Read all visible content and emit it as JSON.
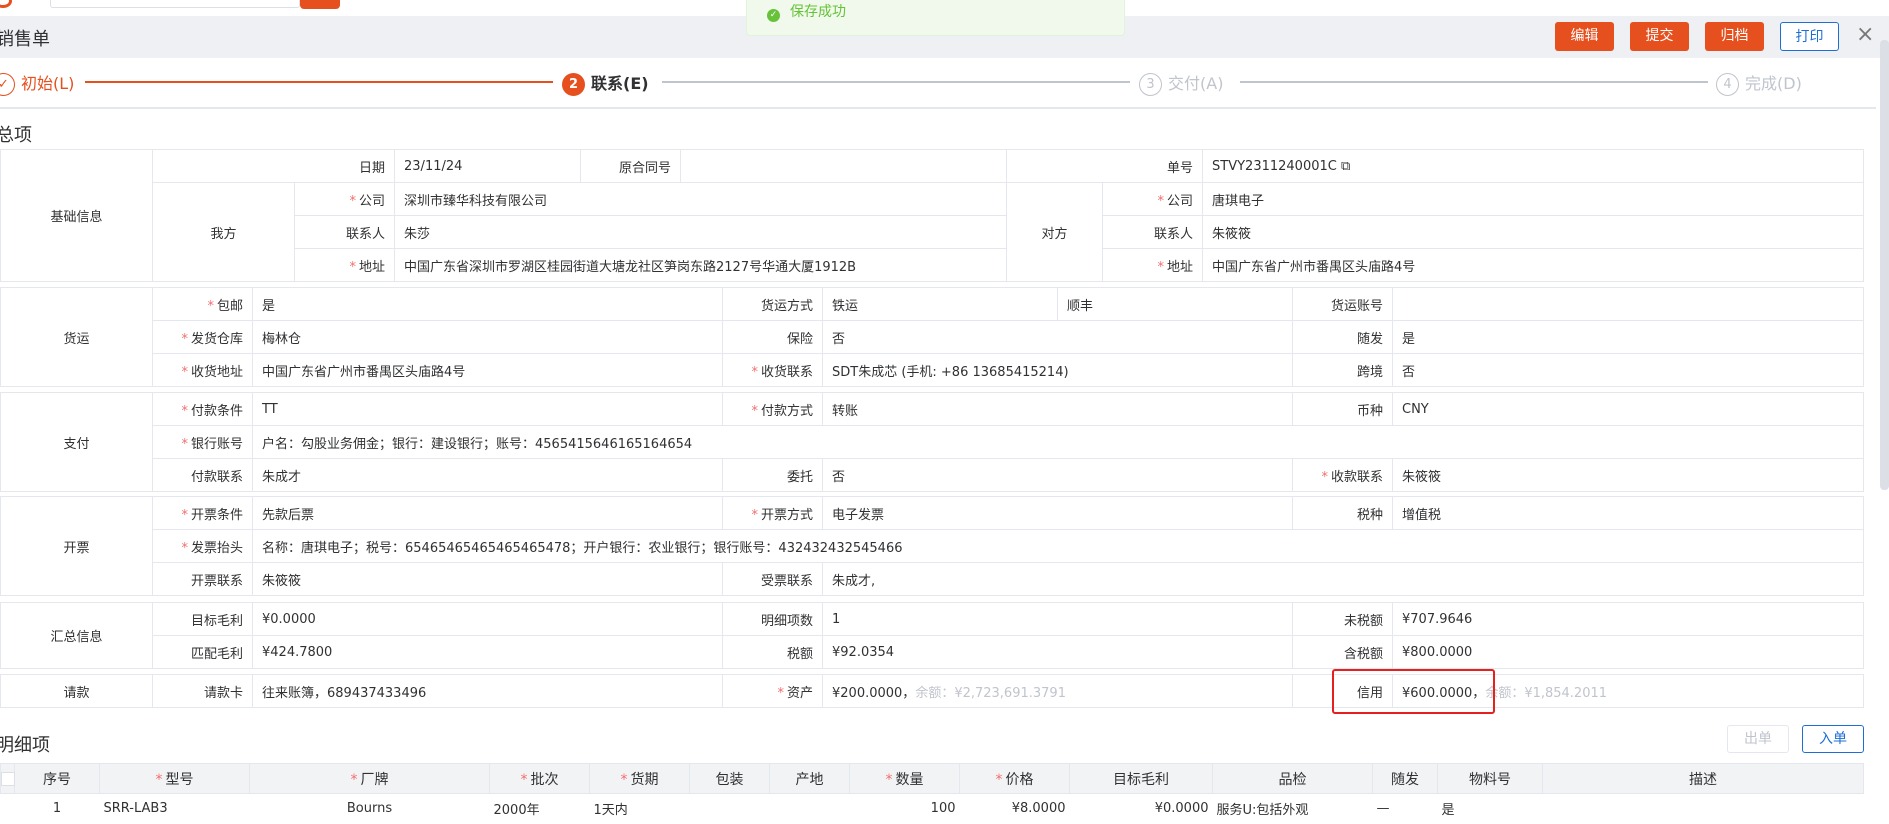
{
  "toast": {
    "text": "保存成功"
  },
  "header": {
    "title": "销售单",
    "buttons": {
      "edit": "编辑",
      "submit": "提交",
      "archive": "归档",
      "print": "打印"
    },
    "close": "×"
  },
  "steps": [
    {
      "num": "✓",
      "label": "初始(L)"
    },
    {
      "num": "2",
      "label": "联系(E)"
    },
    {
      "num": "3",
      "label": "交付(A)"
    },
    {
      "num": "4",
      "label": "完成(D)"
    }
  ],
  "summary": {
    "section_title": "总项",
    "basic": {
      "group": "基础信息",
      "date_label": "日期",
      "date": "23/11/24",
      "contract_label": "原合同号",
      "contract": "",
      "no_label": "单号",
      "no": "STVY2311240001C",
      "us_label": "我方",
      "them_label": "对方",
      "company_label": "公司",
      "contact_label": "联系人",
      "address_label": "地址",
      "us_company": "深圳市臻华科技有限公司",
      "us_contact": "朱莎",
      "us_address": "中国广东省深圳市罗湖区桂园街道大塘龙社区笋岗东路2127号华通大厦1912B",
      "them_company": "唐琪电子",
      "them_contact": "朱筱筱",
      "them_address": "中国广东省广州市番禺区头庙路4号"
    },
    "shipping": {
      "group": "货运",
      "free_label": "包邮",
      "free": "是",
      "method_label": "货运方式",
      "method": "铁运",
      "carrier": "顺丰",
      "account_label": "货运账号",
      "account": "",
      "warehouse_label": "发货仓库",
      "warehouse": "梅林仓",
      "insurance_label": "保险",
      "insurance": "否",
      "follow_label": "随发",
      "follow": "是",
      "recv_addr_label": "收货地址",
      "recv_addr": "中国广东省广州市番禺区头庙路4号",
      "recv_contact_label": "收货联系",
      "recv_contact": "SDT朱成芯 (手机: +86 13685415214)",
      "cross_label": "跨境",
      "cross": "否"
    },
    "payment": {
      "group": "支付",
      "terms_label": "付款条件",
      "terms": "TT",
      "method_label": "付款方式",
      "method": "转账",
      "currency_label": "币种",
      "currency": "CNY",
      "bank_label": "银行账号",
      "bank": "户名：勾股业务佣金；银行：建设银行；账号：4565415646165164654",
      "contact_label": "付款联系",
      "contact": "朱成才",
      "entrust_label": "委托",
      "entrust": "否",
      "recv_label": "收款联系",
      "recv": "朱筱筱"
    },
    "invoice": {
      "group": "开票",
      "terms_label": "开票条件",
      "terms": "先款后票",
      "method_label": "开票方式",
      "method": "电子发票",
      "tax_label": "税种",
      "tax": "增值税",
      "header_label": "发票抬头",
      "header": "名称：唐琪电子；税号：65465465465465465478；开户银行：农业银行；银行账号：432432432545466",
      "contact_label": "开票联系",
      "contact": "朱筱筱",
      "recv_label": "受票联系",
      "recv": "朱成才,"
    },
    "totals": {
      "group": "汇总信息",
      "target_label": "目标毛利",
      "target": "¥0.0000",
      "items_label": "明细项数",
      "items": "1",
      "pretax_label": "未税额",
      "pretax": "¥707.9646",
      "match_label": "匹配毛利",
      "match": "¥424.7800",
      "taxamt_label": "税额",
      "taxamt": "¥92.0354",
      "withtax_label": "含税额",
      "withtax": "¥800.0000"
    },
    "request": {
      "group": "请款",
      "card_label": "请款卡",
      "card": "往来账簿，689437433496",
      "asset_label": "资产",
      "asset": "¥200.0000，",
      "asset_bal": "余额：¥2,723,691.3791",
      "credit_label": "信用",
      "credit": "¥600.0000，",
      "credit_bal": "余额：¥1,854.2011"
    }
  },
  "detail": {
    "section_title": "明细项",
    "out_btn": "出单",
    "in_btn": "入单",
    "columns": [
      "序号",
      "型号",
      "厂牌",
      "批次",
      "货期",
      "包装",
      "产地",
      "数量",
      "价格",
      "目标毛利",
      "品检",
      "随发",
      "物料号",
      "描述"
    ],
    "row": [
      "1",
      "SRR-LAB3",
      "Bourns",
      "2000年",
      "1天内",
      "",
      "",
      "100",
      "¥8.0000",
      "¥0.0000",
      "服务U:包括外观",
      "—",
      "是",
      ""
    ]
  }
}
